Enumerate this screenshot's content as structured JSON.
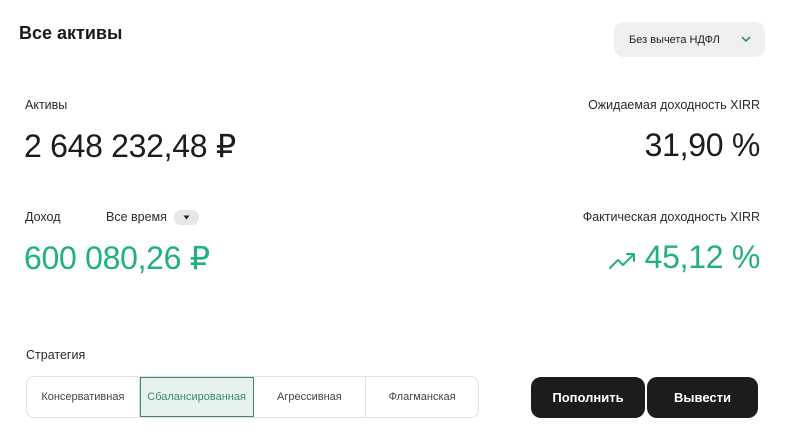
{
  "header": {
    "title": "Все активы"
  },
  "tax_select": {
    "value": "Без вычета НДФЛ",
    "icon": "chevron-down-icon"
  },
  "assets": {
    "label": "Активы",
    "value": "2 648 232,48 ₽"
  },
  "expected_xirr": {
    "label": "Ожидаемая доходность XIRR",
    "value": "31,90 %"
  },
  "income": {
    "label": "Доход",
    "period_label": "Все время",
    "value": "600 080,26 ₽"
  },
  "actual_xirr": {
    "label": "Фактическая доходность XIRR",
    "value": "45,12 %",
    "icon": "trend-up-icon"
  },
  "strategy": {
    "label": "Стратегия",
    "options": [
      "Консервативная",
      "Сбалансированная",
      "Агрессивная",
      "Флагманская"
    ],
    "selected": "Сбалансированная"
  },
  "actions": {
    "deposit": "Пополнить",
    "withdraw": "Вывести"
  },
  "colors": {
    "accent_green": "#21b07f",
    "dark_button": "#1c1c1e",
    "selected_border": "#3c8a6d"
  }
}
